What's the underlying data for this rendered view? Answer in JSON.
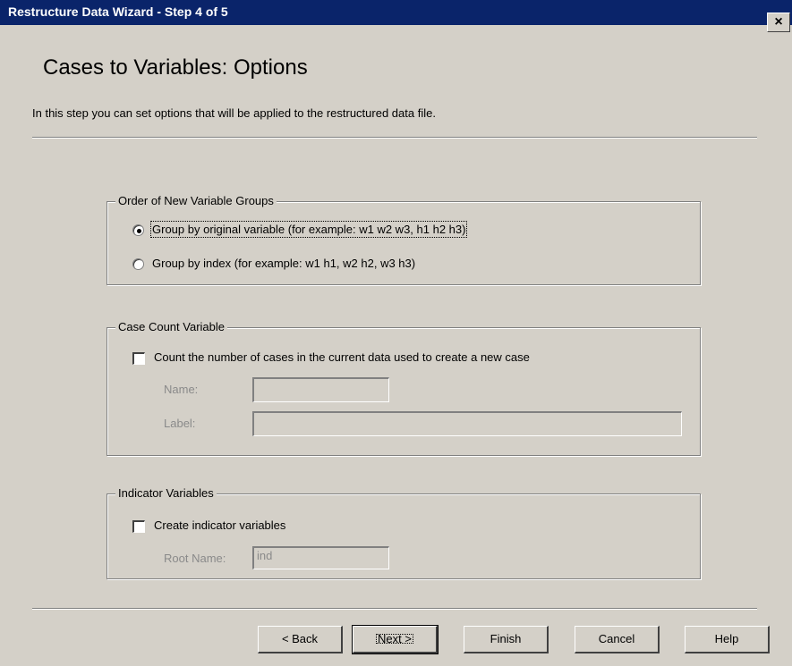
{
  "window": {
    "title": "Restructure Data Wizard - Step 4 of 5",
    "close_label": "×"
  },
  "page": {
    "heading": "Cases to Variables: Options",
    "intro": "In this step you can set options that will be applied to the restructured data file."
  },
  "order_group": {
    "legend": "Order of New Variable Groups",
    "options": [
      {
        "label": "Group by original variable (for example: w1 w2 w3, h1 h2 h3)",
        "selected": true
      },
      {
        "label": "Group by index (for example: w1 h1, w2 h2, w3 h3)",
        "selected": false
      }
    ]
  },
  "case_count_group": {
    "legend": "Case Count Variable",
    "checkbox_label": "Count the number of cases in the current data used to create a new case",
    "checked": false,
    "name_label": "Name:",
    "name_value": "",
    "label_label": "Label:",
    "label_value": ""
  },
  "indicator_group": {
    "legend": "Indicator Variables",
    "checkbox_label": "Create indicator variables",
    "checked": false,
    "root_name_label": "Root Name:",
    "root_name_value": "ind"
  },
  "buttons": {
    "back": "< Back",
    "next": "Next >",
    "finish": "Finish",
    "cancel": "Cancel",
    "help": "Help"
  }
}
